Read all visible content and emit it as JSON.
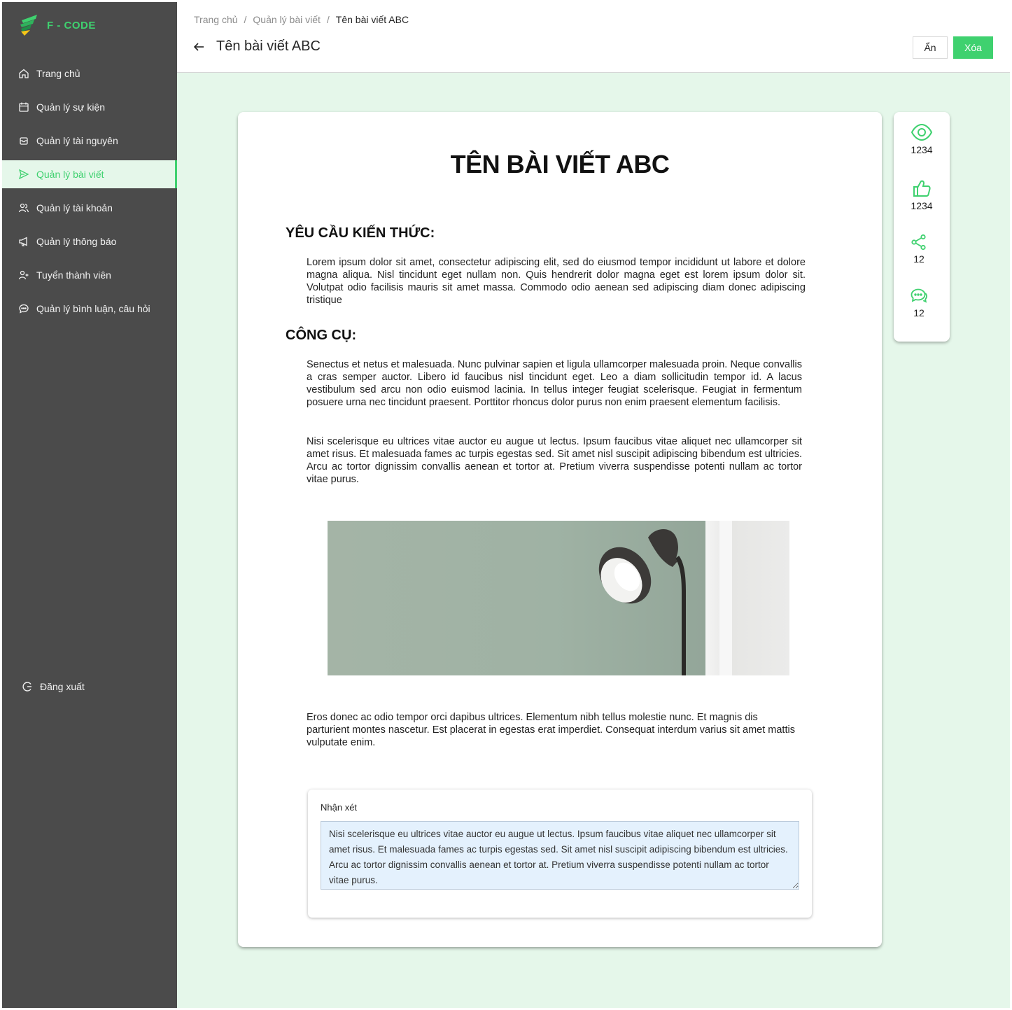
{
  "brand": {
    "name": "F - CODE"
  },
  "sidebar": {
    "items": [
      {
        "label": "Trang chủ"
      },
      {
        "label": "Quản lý sự kiện"
      },
      {
        "label": "Quản lý tài nguyên"
      },
      {
        "label": "Quản lý bài viết"
      },
      {
        "label": "Quản lý tài khoản"
      },
      {
        "label": "Quản lý thông báo"
      },
      {
        "label": "Tuyển thành viên"
      },
      {
        "label": "Quản lý bình luận, câu hỏi"
      }
    ],
    "active_item": "Quản lý bài viết",
    "logout_label": "Đăng xuất"
  },
  "header": {
    "breadcrumb": [
      "Trang chủ",
      "Quản lý bài viết",
      "Tên bài viết ABC"
    ],
    "separator": "/",
    "title": "Tên bài viết ABC",
    "hide_label": "Ẩn",
    "delete_label": "Xóa"
  },
  "article": {
    "title": "TÊN BÀI VIẾT ABC",
    "section1_heading": "YÊU CẦU KIẾN THỨC:",
    "section1_text": "Lorem ipsum dolor sit amet, consectetur adipiscing elit, sed do eiusmod tempor incididunt ut labore et dolore magna aliqua. Nisl tincidunt eget nullam non. Quis hendrerit dolor magna eget est lorem ipsum dolor sit. Volutpat odio facilisis mauris sit amet massa. Commodo odio aenean sed adipiscing diam donec adipiscing tristique",
    "section2_heading": "CÔNG CỤ:",
    "section2_text1": "Senectus et netus et malesuada. Nunc pulvinar sapien et ligula ullamcorper malesuada proin. Neque convallis a cras semper auctor. Libero id faucibus nisl tincidunt eget. Leo a diam sollicitudin tempor id. A lacus vestibulum sed arcu non odio euismod lacinia. In tellus integer feugiat scelerisque. Feugiat in fermentum posuere urna nec tincidunt praesent. Porttitor rhoncus dolor purus non enim praesent elementum facilisis.",
    "section2_text2": "Nisi scelerisque eu ultrices vitae auctor eu augue ut lectus. Ipsum faucibus vitae aliquet nec ullamcorper sit amet risus. Et malesuada fames ac turpis egestas sed. Sit amet nisl suscipit adipiscing bibendum est ultricies. Arcu ac tortor dignissim convallis aenean et tortor at. Pretium viverra suspendisse potenti nullam ac tortor vitae purus.",
    "closing_text": "Eros donec ac odio tempor orci dapibus ultrices. Elementum nibh tellus molestie nunc. Et magnis dis parturient montes nascetur. Est placerat in egestas erat imperdiet. Consequat interdum varius sit amet mattis vulputate enim."
  },
  "comment": {
    "label": "Nhận xét",
    "value": "Nisi scelerisque eu ultrices vitae auctor eu augue ut lectus. Ipsum faucibus vitae aliquet nec ullamcorper sit amet risus. Et malesuada fames ac turpis egestas sed. Sit amet nisl suscipit adipiscing bibendum est ultricies. Arcu ac tortor dignissim convallis aenean et tortor at. Pretium viverra suspendisse potenti nullam ac tortor vitae purus."
  },
  "stats": {
    "views": "1234",
    "likes": "1234",
    "shares": "12",
    "comments": "12",
    "icons": [
      "eye-icon",
      "thumbs-up-icon",
      "share-icon",
      "chat-icon"
    ]
  },
  "colors": {
    "accent": "#3fd16f",
    "sidebar_bg": "#4b4b4b",
    "content_bg": "#e5f7ea",
    "comment_bg": "#e4f1fd"
  }
}
